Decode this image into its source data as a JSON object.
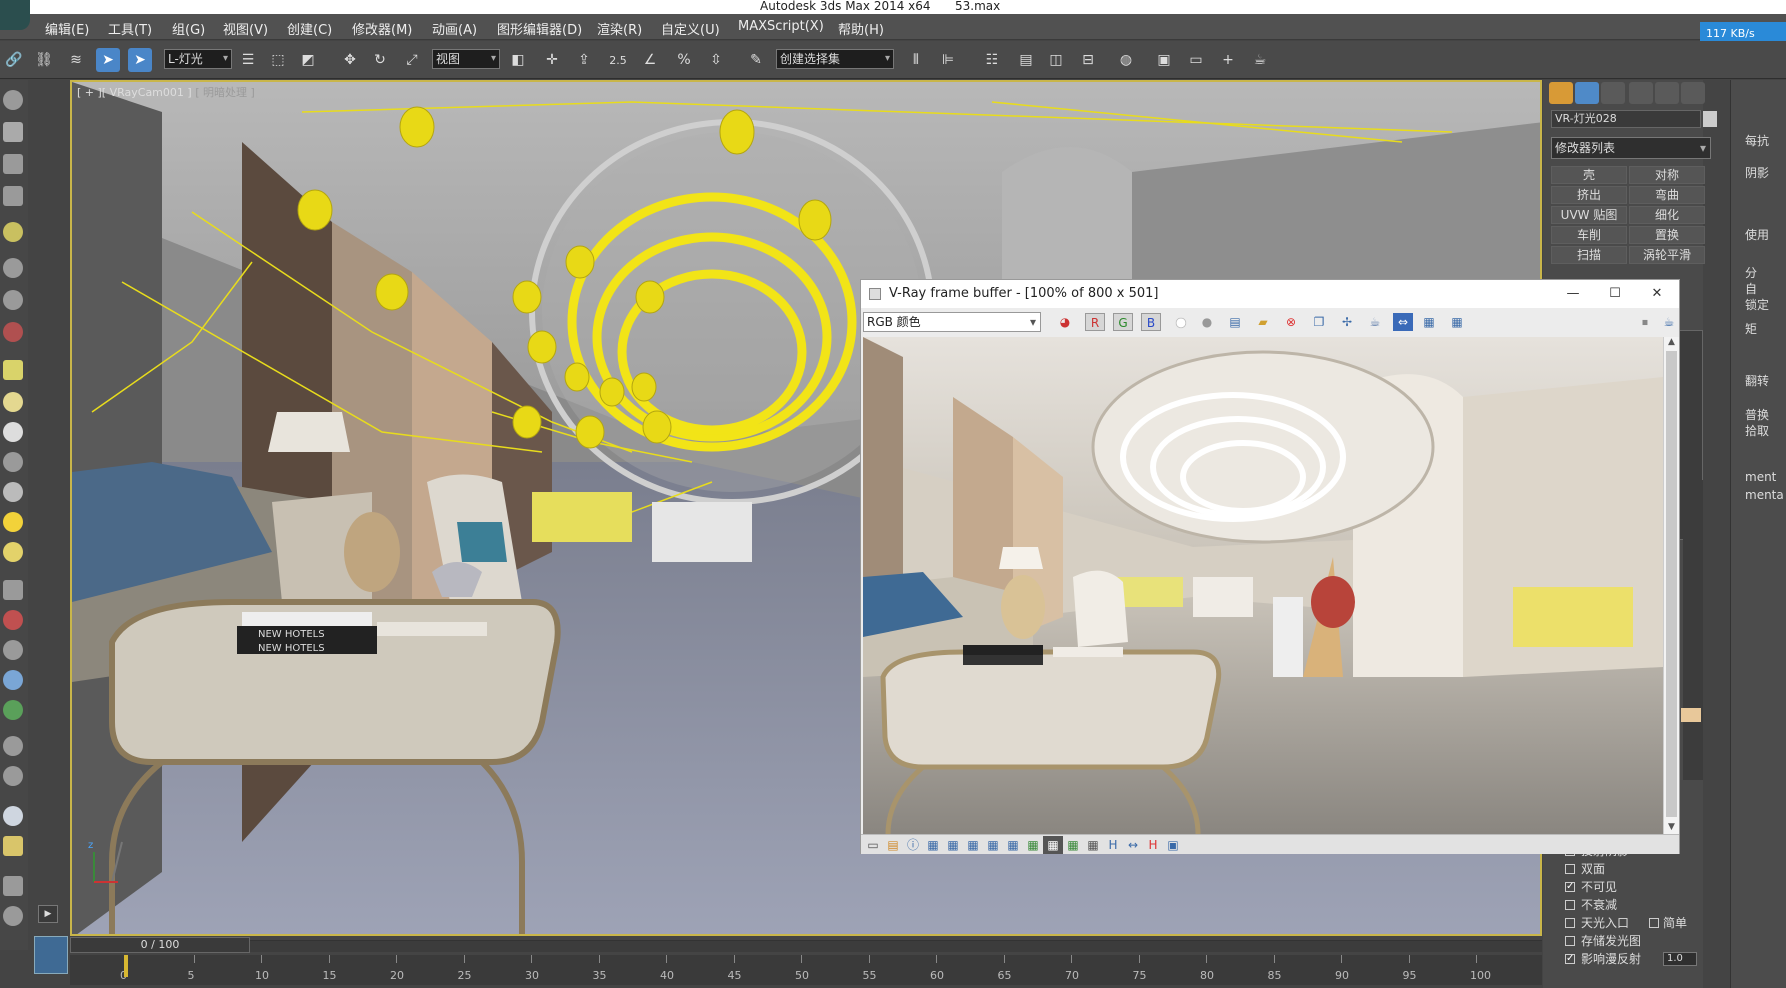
{
  "title_bar": {
    "app": "Autodesk 3ds Max  2014 x64",
    "file": "53.max"
  },
  "menu": [
    "编辑(E)",
    "工具(T)",
    "组(G)",
    "视图(V)",
    "创建(C)",
    "修改器(M)",
    "动画(A)",
    "图形编辑器(D)",
    "渲染(R)",
    "自定义(U)",
    "MAXScript(X)",
    "帮助(H)"
  ],
  "cloud_badge": "117 KB/s",
  "toolbar": {
    "filter_select": "L-灯光",
    "refcoord_select": "视图",
    "snap_angle": "2.5",
    "named_selection": "创建选择集"
  },
  "viewport": {
    "label_prefix": "[ + ]",
    "camera": "[ VRayCam001 ]",
    "shading": "[ 明暗处理 ]",
    "book_text": "NEW HOTELS",
    "axis_z": "z"
  },
  "timeline": {
    "frame_display": "0 / 100",
    "ruler_ticks": [
      "0",
      "5",
      "10",
      "15",
      "20",
      "25",
      "30",
      "35",
      "40",
      "45",
      "50",
      "55",
      "60",
      "65",
      "70",
      "75",
      "80",
      "85",
      "90",
      "95",
      "100"
    ]
  },
  "command_panel": {
    "object_name": "VR-灯光028",
    "modifier_list": "修改器列表",
    "modifier_buttons": [
      [
        "壳",
        "对称"
      ],
      [
        "挤出",
        "弯曲"
      ],
      [
        "UVW 贴图",
        "细化"
      ],
      [
        "车削",
        "置换"
      ],
      [
        "扫描",
        "涡轮平滑"
      ]
    ],
    "checkboxes": [
      {
        "label": "投射阴影",
        "checked": false
      },
      {
        "label": "双面",
        "checked": false
      },
      {
        "label": "不可见",
        "checked": true
      },
      {
        "label": "不衰减",
        "checked": false
      },
      {
        "label": "天光入口",
        "checked": false
      },
      {
        "label": "简单",
        "checked": false
      },
      {
        "label": "存储发光图",
        "checked": false
      },
      {
        "label": "影响漫反射",
        "checked": true
      }
    ],
    "diffuse_value": "1.0"
  },
  "far_panel": {
    "labels": [
      "每抗",
      "阴影",
      "使用",
      "分",
      "自",
      "锁定",
      "矩",
      "翻转",
      "普换",
      "拾取",
      "ment",
      "menta"
    ]
  },
  "vfb": {
    "title": "V-Ray frame buffer - [100% of 800 x 501]",
    "channel": "RGB 颜色",
    "channel_buttons": [
      "R",
      "G",
      "B"
    ],
    "window_controls": [
      "—",
      "☐",
      "✕"
    ]
  }
}
